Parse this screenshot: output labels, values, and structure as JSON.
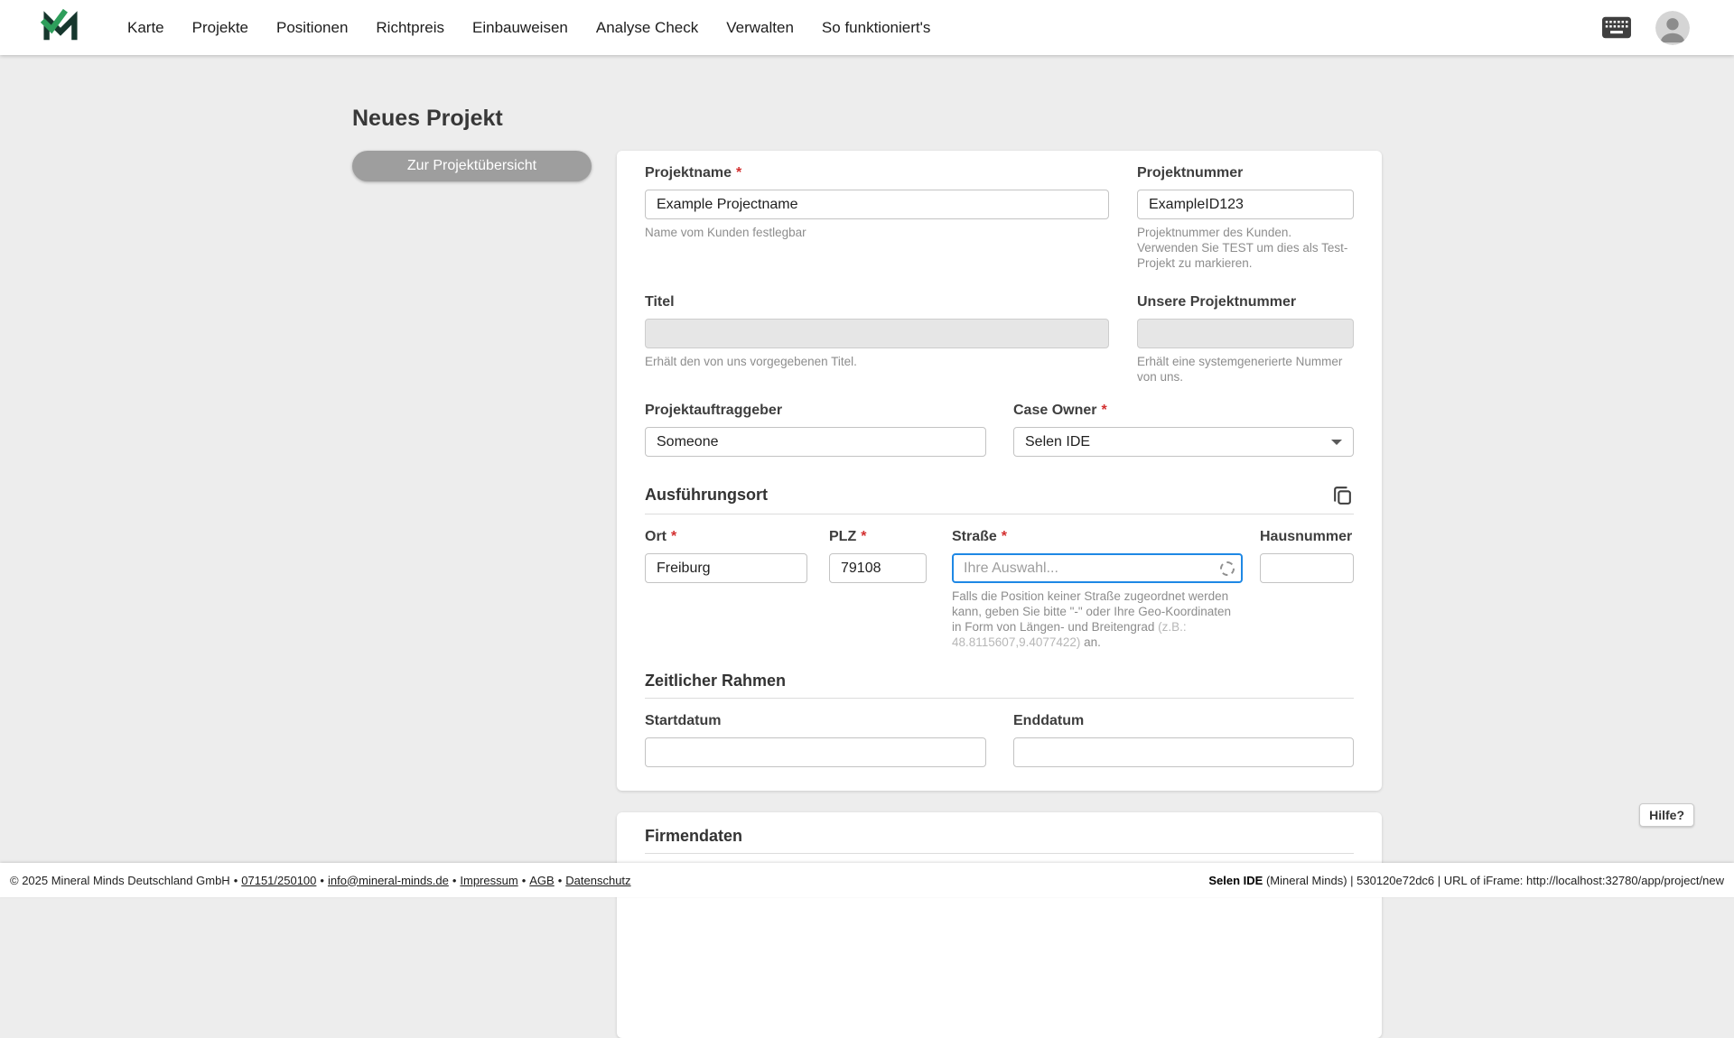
{
  "ui": {
    "required_mark": "*"
  },
  "navbar": {
    "items": [
      {
        "label": "Karte"
      },
      {
        "label": "Projekte"
      },
      {
        "label": "Positionen"
      },
      {
        "label": "Richtpreis"
      },
      {
        "label": "Einbauweisen"
      },
      {
        "label": "Analyse Check"
      },
      {
        "label": "Verwalten"
      },
      {
        "label": "So funktioniert's"
      }
    ]
  },
  "page": {
    "title": "Neues Projekt",
    "back_button_label": "Zur Projektübersicht"
  },
  "form": {
    "projektname": {
      "label": "Projektname",
      "value": "Example Projectname",
      "helper": "Name vom Kunden festlegbar"
    },
    "projektnummer": {
      "label": "Projektnummer",
      "value": "ExampleID123",
      "helper": "Projektnummer des Kunden. Verwenden Sie TEST um dies als Test-Projekt zu markieren."
    },
    "titel": {
      "label": "Titel",
      "helper": "Erhält den von uns vorgegebenen Titel."
    },
    "unsere_projektnummer": {
      "label": "Unsere Projektnummer",
      "helper": "Erhält eine systemgenerierte Nummer von uns."
    },
    "projektauftraggeber": {
      "label": "Projektauftraggeber",
      "value": "Someone"
    },
    "case_owner": {
      "label": "Case Owner",
      "value": "Selen IDE"
    },
    "sections": {
      "ausfuehrungsort": "Ausführungsort",
      "zeitlicher_rahmen": "Zeitlicher Rahmen",
      "firmendaten": "Firmendaten"
    },
    "ort": {
      "label": "Ort",
      "value": "Freiburg"
    },
    "plz": {
      "label": "PLZ",
      "value": "79108"
    },
    "strasse": {
      "label": "Straße",
      "placeholder": "Ihre Auswahl...",
      "helper_text": "Falls die Position keiner Straße zugeordnet werden kann, geben Sie bitte \"-\" oder Ihre Geo-Koordinaten in Form von Längen- und Breitengrad ",
      "helper_example": "(z.B.: 48.8115607,9.4077422)",
      "helper_suffix": " an."
    },
    "hausnummer": {
      "label": "Hausnummer"
    },
    "startdatum": {
      "label": "Startdatum"
    },
    "enddatum": {
      "label": "Enddatum"
    }
  },
  "help": {
    "label": "Hilfe?"
  },
  "footer": {
    "copyright": "© 2025 Mineral Minds Deutschland GmbH",
    "separator": "•",
    "phone": "07151/250100",
    "email": "info@mineral-minds.de",
    "impressum": "Impressum",
    "agb": "AGB",
    "datenschutz": "Datenschutz",
    "session_user": "Selen IDE",
    "session_info": " (Mineral Minds) | 530120e72dc6 | URL of iFrame: http://localhost:32780/app/project/new"
  },
  "colors": {
    "accent_green": "#2e9e5b",
    "focus_blue": "#1e88e5",
    "required_red": "#d32f2f",
    "button_gray": "#9e9e9e"
  }
}
